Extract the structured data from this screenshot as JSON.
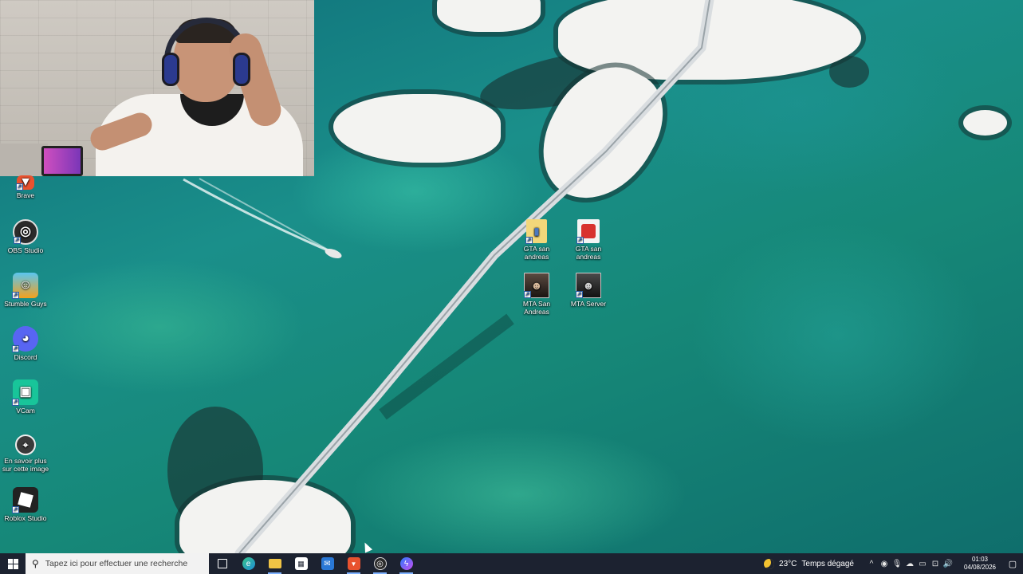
{
  "desktop_icons_left": [
    {
      "key": "brave",
      "label": "Brave",
      "icon": "brave-icon",
      "color": "#e8522f"
    },
    {
      "key": "obs",
      "label": "OBS Studio",
      "icon": "obs-icon",
      "color": "#2b2b2b"
    },
    {
      "key": "stumble",
      "label": "Stumble Guys",
      "icon": "stumble-guys-icon",
      "color": "#f3a11d"
    },
    {
      "key": "discord",
      "label": "Discord",
      "icon": "discord-icon",
      "color": "#5865f2"
    },
    {
      "key": "vcam",
      "label": "VCam",
      "icon": "vcam-icon",
      "color": "#18c59a"
    },
    {
      "key": "spotlight",
      "label": "En savoir plus sur cette image",
      "icon": "spotlight-icon",
      "color": "#3a3a3a"
    },
    {
      "key": "roblox",
      "label": "Roblox Studio",
      "icon": "roblox-studio-icon",
      "color": "#222222"
    }
  ],
  "desktop_icons_middle": [
    {
      "key": "gta1",
      "label": "GTA san andreas",
      "icon": "folder-document-icon",
      "color": "#f2d77a"
    },
    {
      "key": "gta2",
      "label": "GTA san andreas",
      "icon": "gta-sa-icon",
      "color": "#d8322f"
    },
    {
      "key": "mta1",
      "label": "MTA San Andreas",
      "icon": "mta-icon",
      "color": "#3a2a22"
    },
    {
      "key": "mta2",
      "label": "MTA Server",
      "icon": "mta-server-icon",
      "color": "#2e2e2e"
    }
  ],
  "taskbar": {
    "search_placeholder": "Tapez ici pour effectuer une recherche",
    "pinned": [
      {
        "name": "task-view-icon",
        "color": "#1c2230"
      },
      {
        "name": "edge-icon",
        "color": "#1f8fd6"
      },
      {
        "name": "file-explorer-icon",
        "color": "#f0c445"
      },
      {
        "name": "microsoft-store-icon",
        "color": "#ffffff"
      },
      {
        "name": "mail-icon",
        "color": "#2a78d6"
      },
      {
        "name": "brave-icon",
        "color": "#e8522f"
      },
      {
        "name": "obs-icon",
        "color": "#2b2b2b"
      },
      {
        "name": "messenger-icon",
        "color": "#8a5cf2"
      }
    ],
    "weather": {
      "temp": "23°C",
      "condition": "Temps dégagé"
    },
    "time": "01:03",
    "date": "04/08/2026"
  }
}
